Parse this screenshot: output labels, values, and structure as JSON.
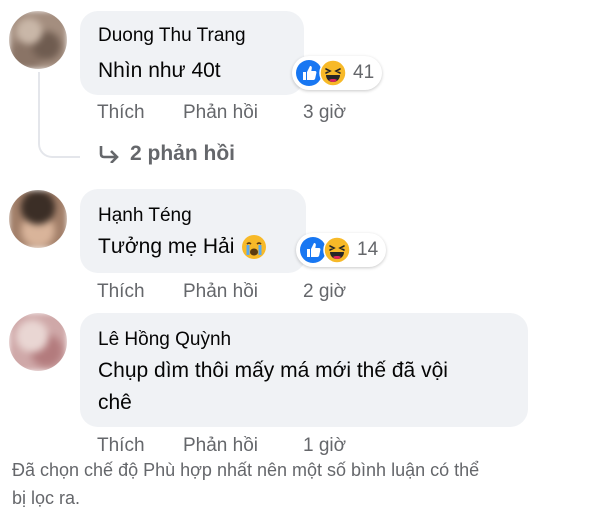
{
  "comments": [
    {
      "author": "Duong Thu Trang",
      "text": "Nhìn như 40t",
      "reaction_count": "41",
      "reactions": [
        "like-icon",
        "haha-icon"
      ],
      "actions": {
        "like": "Thích",
        "reply": "Phản hồi",
        "time": "3 giờ"
      },
      "replies_label": "2 phản hồi"
    },
    {
      "author": "Hạnh Téng",
      "text": "Tưởng mẹ Hải",
      "emoji": "crying-face-icon",
      "reaction_count": "14",
      "reactions": [
        "like-icon",
        "haha-icon"
      ],
      "actions": {
        "like": "Thích",
        "reply": "Phản hồi",
        "time": "2 giờ"
      }
    },
    {
      "author": "Lê Hồng Quỳnh",
      "text_line1": "Chụp dìm thôi mấy má mới thế đã vội",
      "text_line2": "chê",
      "actions": {
        "like": "Thích",
        "reply": "Phản hồi",
        "time": "1 giờ"
      }
    }
  ],
  "footer_line1": "Đã chọn chế độ Phù hợp nhất nên một số bình luận có thể",
  "footer_line2": "bị lọc ra.",
  "colors": {
    "bubble": "#f0f2f5",
    "secondary_text": "#65676b",
    "like_blue": "#1877f2",
    "haha_yellow": "#f7b928"
  }
}
